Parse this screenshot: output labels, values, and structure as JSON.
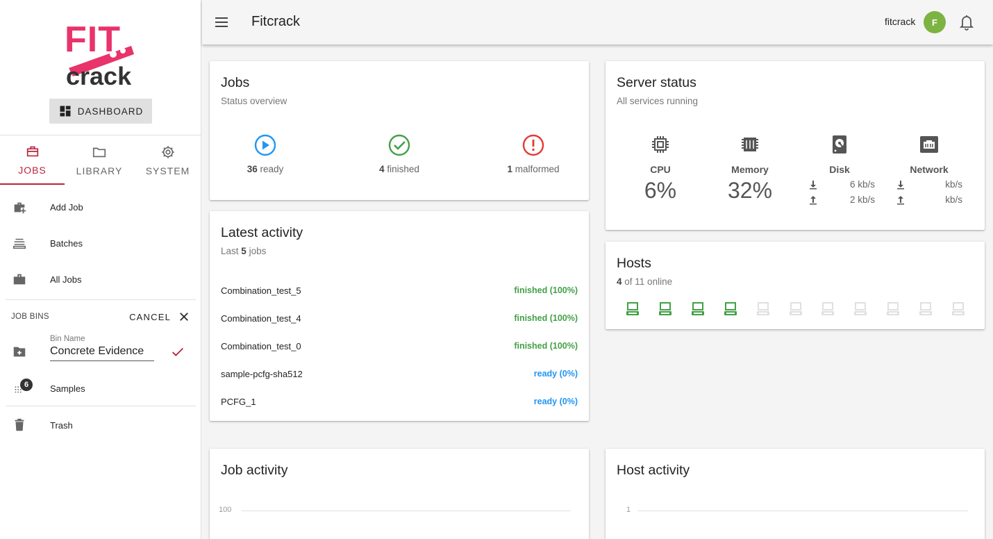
{
  "colors": {
    "brand": "#e8336b",
    "accent": "#b8233b",
    "finished": "#43a047",
    "ready": "#2196f3",
    "malformed": "#e53935",
    "host_online": "#43a047",
    "host_offline": "#e0e0e0",
    "avatar": "#7cb342"
  },
  "logo": {
    "line1": "FIT",
    "line2": "crack"
  },
  "sidebar": {
    "dashboard_label": "DASHBOARD",
    "tabs": [
      {
        "label": "JOBS",
        "icon": "briefcase-icon",
        "active": true
      },
      {
        "label": "LIBRARY",
        "icon": "folder-icon",
        "active": false
      },
      {
        "label": "SYSTEM",
        "icon": "gear-icon",
        "active": false
      }
    ],
    "items": [
      {
        "label": "Add Job",
        "icon": "briefcase-plus-icon"
      },
      {
        "label": "Batches",
        "icon": "batches-icon"
      },
      {
        "label": "All Jobs",
        "icon": "briefcase-icon"
      }
    ],
    "job_bins": {
      "title": "JOB BINS",
      "cancel_label": "CANCEL",
      "field_label": "Bin Name",
      "field_value": "Concrete Evidence",
      "bins": [
        {
          "label": "Samples",
          "count": "6"
        }
      ]
    },
    "trash_label": "Trash"
  },
  "topbar": {
    "title": "Fitcrack",
    "username": "fitcrack",
    "avatar_letter": "F"
  },
  "jobs_card": {
    "title": "Jobs",
    "subtitle": "Status overview",
    "stats": [
      {
        "count": "36",
        "label": "ready",
        "icon": "play-circle-icon"
      },
      {
        "count": "4",
        "label": "finished",
        "icon": "check-circle-icon"
      },
      {
        "count": "1",
        "label": "malformed",
        "icon": "alert-circle-icon"
      }
    ]
  },
  "activity_card": {
    "title": "Latest activity",
    "subtitle_pre": "Last",
    "subtitle_count": "5",
    "subtitle_post": "jobs",
    "rows": [
      {
        "name": "Combination_test_5",
        "status": "finished (100%)",
        "kind": "finished"
      },
      {
        "name": "Combination_test_4",
        "status": "finished (100%)",
        "kind": "finished"
      },
      {
        "name": "Combination_test_0",
        "status": "finished (100%)",
        "kind": "finished"
      },
      {
        "name": "sample-pcfg-sha512",
        "status": "ready (0%)",
        "kind": "ready"
      },
      {
        "name": "PCFG_1",
        "status": "ready (0%)",
        "kind": "ready"
      }
    ]
  },
  "server_card": {
    "title": "Server status",
    "subtitle": "All services running",
    "cpu": {
      "label": "CPU",
      "value": "6%"
    },
    "memory": {
      "label": "Memory",
      "value": "32%"
    },
    "disk": {
      "label": "Disk",
      "down": "6 kb/s",
      "up": "2 kb/s"
    },
    "network": {
      "label": "Network",
      "down": "kb/s",
      "up": "kb/s"
    }
  },
  "hosts_card": {
    "title": "Hosts",
    "online": "4",
    "of_text": "of 11 online",
    "total": 11,
    "online_count": 4
  },
  "job_activity_card": {
    "title": "Job activity",
    "y_tick": "100"
  },
  "host_activity_card": {
    "title": "Host activity",
    "y_tick": "1"
  }
}
